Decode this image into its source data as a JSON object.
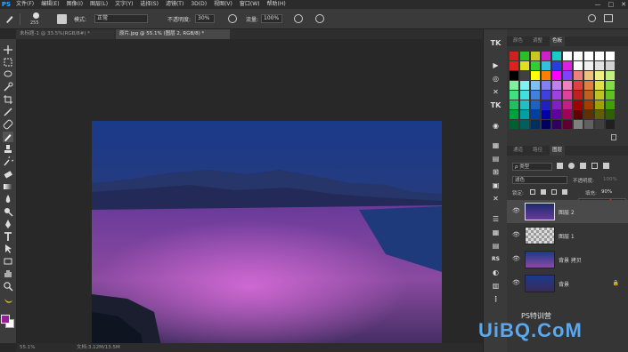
{
  "menu": {
    "logo": "PS",
    "items": [
      "文件(F)",
      "编辑(E)",
      "图像(I)",
      "图层(L)",
      "文字(Y)",
      "选择(S)",
      "滤镜(T)",
      "3D(D)",
      "视图(V)",
      "窗口(W)",
      "帮助(H)"
    ],
    "window_controls": [
      "—",
      "□",
      "✕"
    ]
  },
  "options": {
    "brush_size": "255",
    "mode_label": "模式:",
    "mode_value": "正常",
    "opacity_label": "不透明度:",
    "opacity_value": "30%",
    "flow_label": "流量:",
    "flow_value": "100%"
  },
  "tabs": [
    {
      "label": "未标题-1 @ 33.5%(RGB/8#) *"
    },
    {
      "label": "原片.jpg @ 55.1% (图层 2, RGB/8) *"
    }
  ],
  "status": {
    "zoom": "55.1%",
    "doc": "文档:3.12M/13.5M"
  },
  "right_icons": [
    "TK",
    "▶",
    "◎",
    "✕",
    "TK",
    "◉",
    "▦",
    "▤",
    "⊞",
    "▣",
    "✕",
    "☰",
    "▦",
    "▤",
    "RS",
    "◐",
    "▥",
    "⋮"
  ],
  "swatch_panel": {
    "tabs": [
      "颜色",
      "调整",
      "色板"
    ],
    "active": "色板"
  },
  "swatches": [
    "#d02020",
    "#2ac02a",
    "#c8c820",
    "#d020c8",
    "#20c8c8",
    "#ffffff",
    "#ffffff",
    "#ffffff",
    "#ffffff",
    "#ffffff",
    "#e02020",
    "#e0e020",
    "#30d030",
    "#30c0e0",
    "#2040e0",
    "#e020e0",
    "#ffffff",
    "#f0f0f0",
    "#e0e0e0",
    "#d0d0d0",
    "#000000",
    "#404040",
    "#ffff00",
    "#ff8000",
    "#ff00ff",
    "#8040ff",
    "#f08080",
    "#f0c080",
    "#f0f080",
    "#c0f080",
    "#80f0a0",
    "#80f0f0",
    "#80c0f0",
    "#8080f0",
    "#c080f0",
    "#f080c0",
    "#e04040",
    "#e08040",
    "#e0e040",
    "#80e040",
    "#40e080",
    "#40e0e0",
    "#4080e0",
    "#4040e0",
    "#a040e0",
    "#e040a0",
    "#c02020",
    "#c06020",
    "#c0c020",
    "#60c020",
    "#20c060",
    "#20c0c0",
    "#2060c0",
    "#2020c0",
    "#8020c0",
    "#c02080",
    "#a00000",
    "#a04000",
    "#a0a000",
    "#40a000",
    "#00a040",
    "#00a0a0",
    "#0040a0",
    "#0000a0",
    "#6000a0",
    "#a00060",
    "#600000",
    "#603000",
    "#606000",
    "#306000",
    "#006030",
    "#006060",
    "#003060",
    "#000060",
    "#300060",
    "#600030",
    "#808080",
    "#606060",
    "#404040",
    "#202020"
  ],
  "layers_panel": {
    "tabs": [
      "通道",
      "路径",
      "图层"
    ],
    "active": "图层",
    "filter_label": "ρ 类型",
    "blend_mode": "滤色",
    "opacity_label": "不透明度:",
    "opacity_value": "100%",
    "lock_label": "锁定:",
    "fill_label": "填充:",
    "fill_value": "90%",
    "layers": [
      {
        "name": "图层 2",
        "selected": true,
        "lock": ""
      },
      {
        "name": "图层 1",
        "selected": false,
        "lock": ""
      },
      {
        "name": "背景 拷贝",
        "selected": false,
        "lock": ""
      },
      {
        "name": "背景",
        "selected": false,
        "lock": "🔒"
      }
    ]
  },
  "watermark": {
    "site": "UiBQ.CoM",
    "small": "PS特训营"
  },
  "colors": {
    "fg": "#9a1a9a",
    "bg": "#ffffff",
    "annotation_arrow": "#e02020"
  }
}
